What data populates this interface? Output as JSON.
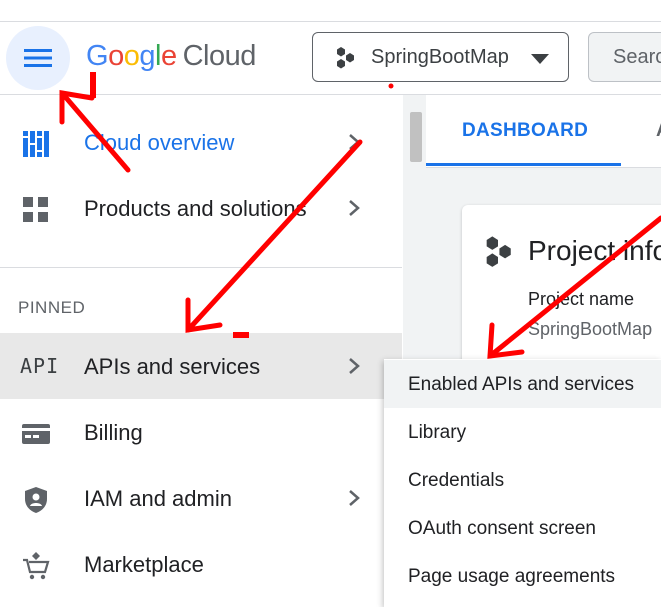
{
  "header": {
    "logo": {
      "google": [
        "G",
        "o",
        "o",
        "g",
        "l",
        "e"
      ],
      "cloud": "Cloud"
    },
    "project_name": "SpringBootMap",
    "search_placeholder": "Search"
  },
  "sidebar": {
    "items": [
      {
        "label": "Cloud overview",
        "icon": "dashboard-icon"
      },
      {
        "label": "Products and solutions",
        "icon": "grid-icon"
      }
    ],
    "pinned_label": "PINNED",
    "pinned": [
      {
        "label": "APIs and services",
        "icon": "api-icon"
      },
      {
        "label": "Billing",
        "icon": "billing-card-icon"
      },
      {
        "label": "IAM and admin",
        "icon": "shield-icon"
      },
      {
        "label": "Marketplace",
        "icon": "cart-icon"
      }
    ],
    "api_icon_text": "API"
  },
  "main": {
    "tabs": [
      "DASHBOARD",
      "A"
    ],
    "card_title": "Project info",
    "project_name_label": "Project name",
    "project_name_value": "SpringBootMap"
  },
  "submenu": {
    "items": [
      "Enabled APIs and services",
      "Library",
      "Credentials",
      "OAuth consent screen",
      "Page usage agreements"
    ]
  },
  "colors": {
    "accent": "#1a73e8",
    "annotation": "#ff0000",
    "google_blue": "#4285f4",
    "google_red": "#ea4335",
    "google_yellow": "#fbbc04",
    "google_green": "#34a853"
  }
}
